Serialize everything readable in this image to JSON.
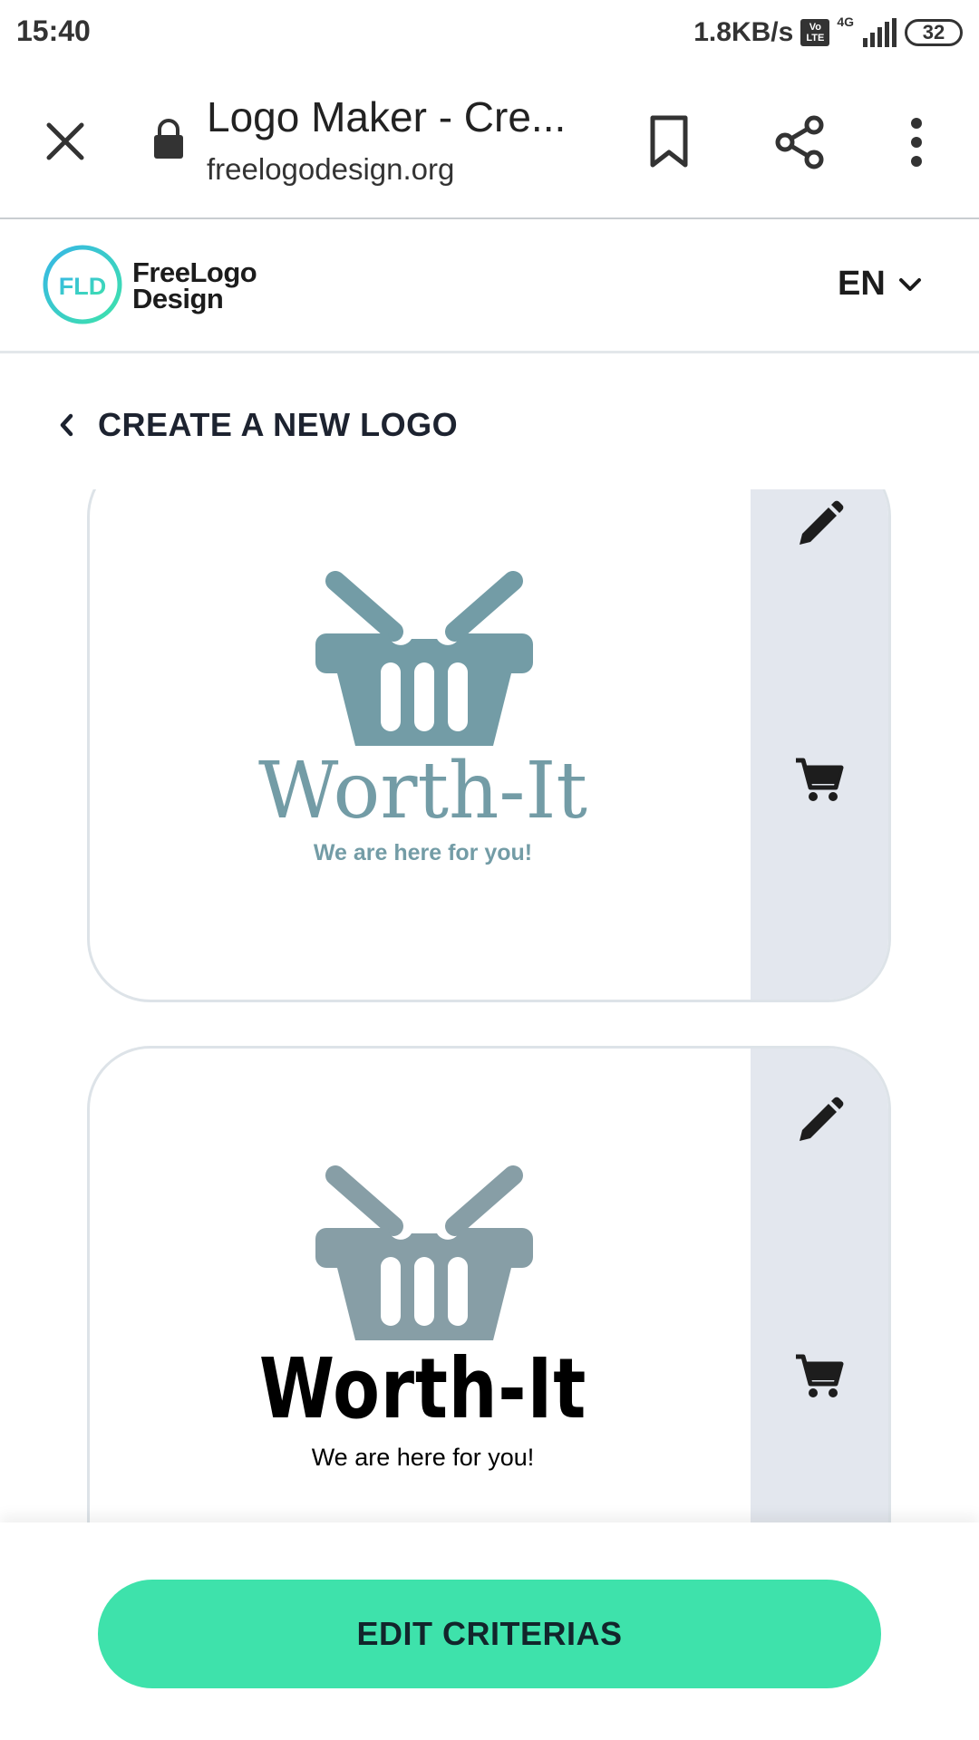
{
  "status": {
    "time": "15:40",
    "speed": "1.8KB/s",
    "volte": "Vo LTE",
    "network": "4G",
    "battery": "32"
  },
  "browser": {
    "title": "Logo Maker - Cre...",
    "url": "freelogodesign.org",
    "icons": [
      "close-icon",
      "lock-icon",
      "bookmark-icon",
      "share-icon",
      "more-vert-icon"
    ]
  },
  "header": {
    "logo_badge": "FLD",
    "logo_name_line1": "FreeLogo",
    "logo_name_line2": "Design",
    "language": "EN"
  },
  "nav": {
    "back_label": "CREATE A NEW LOGO"
  },
  "cards": [
    {
      "brand": "Worth-It",
      "tagline": "We are here for you!",
      "color": "#739ca6",
      "brand_color": "#739ca6",
      "tagline_color": "#739ca6"
    },
    {
      "brand": "Worth-It",
      "tagline": "We are here for you!",
      "color": "#879ea6",
      "brand_color": "#000000",
      "tagline_color": "#000000"
    }
  ],
  "footer": {
    "edit_label": "EDIT CRITERIAS",
    "accent": "#3ee2ab"
  }
}
